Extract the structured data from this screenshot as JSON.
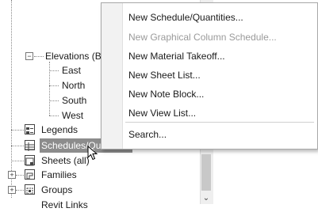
{
  "tree": {
    "elevations_label": "Elevations (B",
    "elevations_children": [
      "East",
      "North",
      "South",
      "West"
    ],
    "legends_label": "Legends",
    "schedules_label": "Schedules/Quantities",
    "sheets_label": "Sheets (all)",
    "families_label": "Families",
    "groups_label": "Groups",
    "revit_links_label": "Revit Links"
  },
  "context_menu": {
    "items": [
      {
        "label": "New Schedule/Quantities...",
        "enabled": true
      },
      {
        "label": "New Graphical Column Schedule...",
        "enabled": false
      },
      {
        "label": "New Material Takeoff...",
        "enabled": true
      },
      {
        "label": "New Sheet List...",
        "enabled": true
      },
      {
        "label": "New Note Block...",
        "enabled": true
      },
      {
        "label": "New View List...",
        "enabled": true
      }
    ],
    "search_label": "Search..."
  },
  "icons": {
    "expander_collapsed": "plus-box-icon",
    "expander_expanded": "minus-box-icon",
    "legends": "legend-icon",
    "schedules": "schedule-icon",
    "sheets": "sheet-icon",
    "families": "family-icon",
    "groups": "group-icon",
    "cursor": "mouse-pointer-icon",
    "scroll_down": "chevron-down-icon"
  }
}
